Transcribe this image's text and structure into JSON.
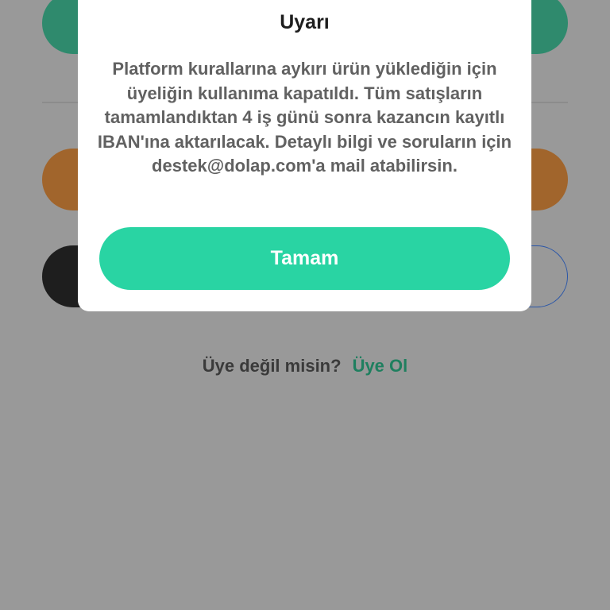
{
  "dialog": {
    "title": "Uyarı",
    "message": "Platform kurallarına aykırı ürün yüklediğin için üyeliğin kullanıma kapatıldı. Tüm satışların tamamlandıktan 4 iş günü sonra kazancın kayıtlı IBAN'ına aktarılacak. Detaylı bilgi ve soruların için destek@dolap.com'a mail atabilirsin.",
    "ok_label": "Tamam"
  },
  "signup": {
    "question": "Üye değil misin?",
    "link": "Üye Ol"
  },
  "colors": {
    "backdrop": "#999999",
    "accent": "#29d4a3",
    "link": "#1f7f5f",
    "dimmed_teal": "#2f8a6d",
    "dimmed_brown": "#a1652c",
    "dimmed_black": "#1e1e1e",
    "outline_blue": "#2a56a8"
  }
}
